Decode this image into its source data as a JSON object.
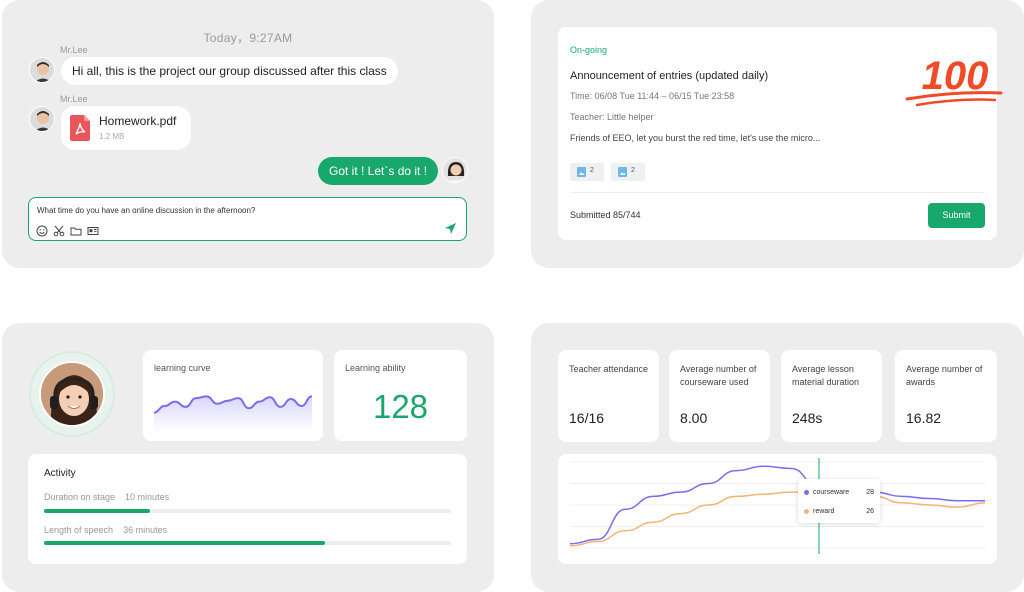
{
  "colors": {
    "accent": "#19a86b",
    "courseware": "#7b6cf0",
    "reward": "#f3b476"
  },
  "chat": {
    "time": "Today，9:27AM",
    "messages": [
      {
        "sender": "Mr.Lee",
        "text": "Hi all, this is the project our group discussed after this class"
      },
      {
        "sender": "Mr.Lee",
        "file": {
          "name": "Homework.pdf",
          "size": "1.2 MB",
          "icon": "pdf-icon"
        }
      }
    ],
    "my_reply": "Got it ! Let`s do it !",
    "input": {
      "value": "What time do you have an online discussion in the afternoon?"
    },
    "toolbar": [
      "emoji-icon",
      "scissors-icon",
      "folder-icon",
      "id-card-icon"
    ],
    "send_icon": "send-icon"
  },
  "announcement": {
    "status": "On-going",
    "title": "Announcement of entries (updated daily)",
    "time": "Time: 06/08 Tue 11:44 – 06/15 Tue 23:58",
    "teacher": "Teacher: Little helper",
    "excerpt": "Friends of EEO, let you burst the red time, let's use the micro...",
    "attachments": [
      {
        "count": "2"
      },
      {
        "count": "2"
      }
    ],
    "submitted": "Submitted 85/744",
    "submit_label": "Submit",
    "stamp": "100"
  },
  "learning": {
    "curve_label": "learning curve",
    "ability_label": "Learning ability",
    "ability_value": "128",
    "activity": {
      "title": "Activity",
      "items": [
        {
          "label": "Duration on stage",
          "value": "10 minutes",
          "progress": 0.26
        },
        {
          "label": "Length of speech",
          "value": "36 minutes",
          "progress": 0.69
        }
      ]
    }
  },
  "stats": {
    "cards": [
      {
        "label": "Teacher attendance",
        "value": "16/16"
      },
      {
        "label": "Average number of courseware used",
        "value": "8.00"
      },
      {
        "label": "Average lesson material duration",
        "value": "248s"
      },
      {
        "label": "Average number of awards",
        "value": "16.82"
      }
    ],
    "tooltip": [
      {
        "name": "courseware",
        "value": "28"
      },
      {
        "name": "reward",
        "value": "26"
      }
    ]
  },
  "chart_data": [
    {
      "type": "line",
      "title": "",
      "xlabel": "",
      "ylabel": "",
      "ylim": [
        0,
        1
      ],
      "grid": false,
      "legend": "none",
      "series": [
        {
          "values": [
            0.35,
            0.5,
            0.6,
            0.48,
            0.68,
            0.72,
            0.55,
            0.62,
            0.68,
            0.45,
            0.6,
            0.7,
            0.48,
            0.66,
            0.5,
            0.72
          ]
        }
      ]
    },
    {
      "type": "line",
      "title": "",
      "xlabel": "",
      "ylabel": "",
      "ylim": [
        0,
        40
      ],
      "grid": true,
      "legend": "none",
      "marker_index": 9,
      "series": [
        {
          "name": "courseware",
          "values": [
            2,
            4,
            18,
            24,
            26,
            30,
            36,
            38,
            37,
            28,
            27,
            26,
            24,
            23,
            22,
            22
          ]
        },
        {
          "name": "reward",
          "values": [
            1,
            3,
            8,
            12,
            16,
            20,
            24,
            25,
            26,
            26,
            25,
            24,
            21,
            20,
            19,
            21
          ]
        }
      ]
    }
  ]
}
